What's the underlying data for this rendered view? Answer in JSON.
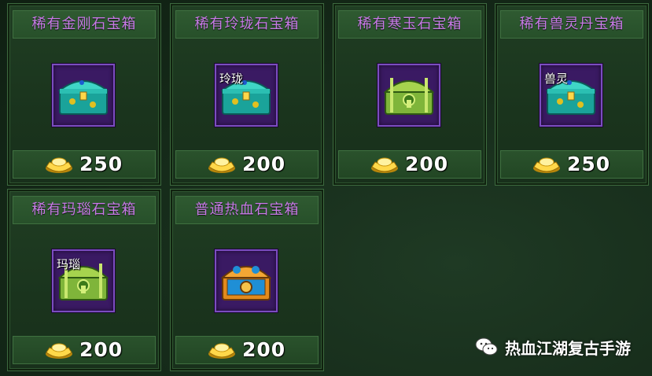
{
  "colors": {
    "title": "#c77ae6",
    "slot_bg": "#3a1a63",
    "slot_border": "#7b4cc0",
    "price": "#ffffff"
  },
  "items": [
    {
      "title": "稀有金刚石宝箱",
      "label": "",
      "price": "250",
      "icon": "teal-chest-icon"
    },
    {
      "title": "稀有玲珑石宝箱",
      "label": "玲珑",
      "price": "200",
      "icon": "teal-chest-icon"
    },
    {
      "title": "稀有寒玉石宝箱",
      "label": "",
      "price": "200",
      "icon": "green-chest-icon"
    },
    {
      "title": "稀有兽灵丹宝箱",
      "label": "兽灵",
      "price": "250",
      "icon": "teal-chest-icon"
    },
    {
      "title": "稀有玛瑙石宝箱",
      "label": "玛瑙",
      "price": "200",
      "icon": "green-chest-icon"
    },
    {
      "title": "普通热血石宝箱",
      "label": "",
      "price": "200",
      "icon": "gold-chest-icon"
    }
  ],
  "currency_icon": "gold-ingot-icon",
  "watermark": {
    "icon": "wechat-icon",
    "text": "热血江湖复古手游"
  }
}
